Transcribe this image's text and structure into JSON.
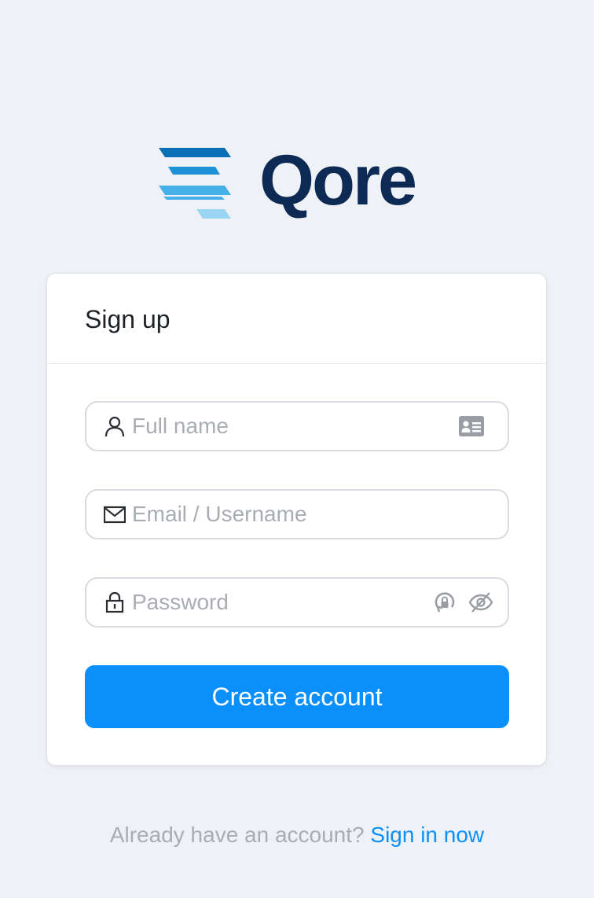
{
  "brand": {
    "name": "Qore",
    "text_color": "#0d2a55",
    "mark_colors": [
      "#0a6fb5",
      "#1e90d6",
      "#45b1e8",
      "#9ad6f2"
    ]
  },
  "card": {
    "title": "Sign up"
  },
  "fields": {
    "full_name": {
      "placeholder": "Full name",
      "value": "",
      "lead_icon": "user-icon",
      "trail_icon": "contact-card-icon"
    },
    "email": {
      "placeholder": "Email / Username",
      "value": "",
      "lead_icon": "mail-icon"
    },
    "password": {
      "placeholder": "Password",
      "value": "",
      "lead_icon": "lock-icon",
      "trail_icons": [
        "password-autofill-icon",
        "eye-slash-icon"
      ]
    }
  },
  "submit": {
    "label": "Create account",
    "color": "#0a8ffb"
  },
  "footer": {
    "prompt": "Already have an account?",
    "link_label": "Sign in now",
    "link_color": "#0a8ffb"
  },
  "colors": {
    "background": "#eef1f5",
    "placeholder": "#a9adb3",
    "title": "#1f2329"
  }
}
